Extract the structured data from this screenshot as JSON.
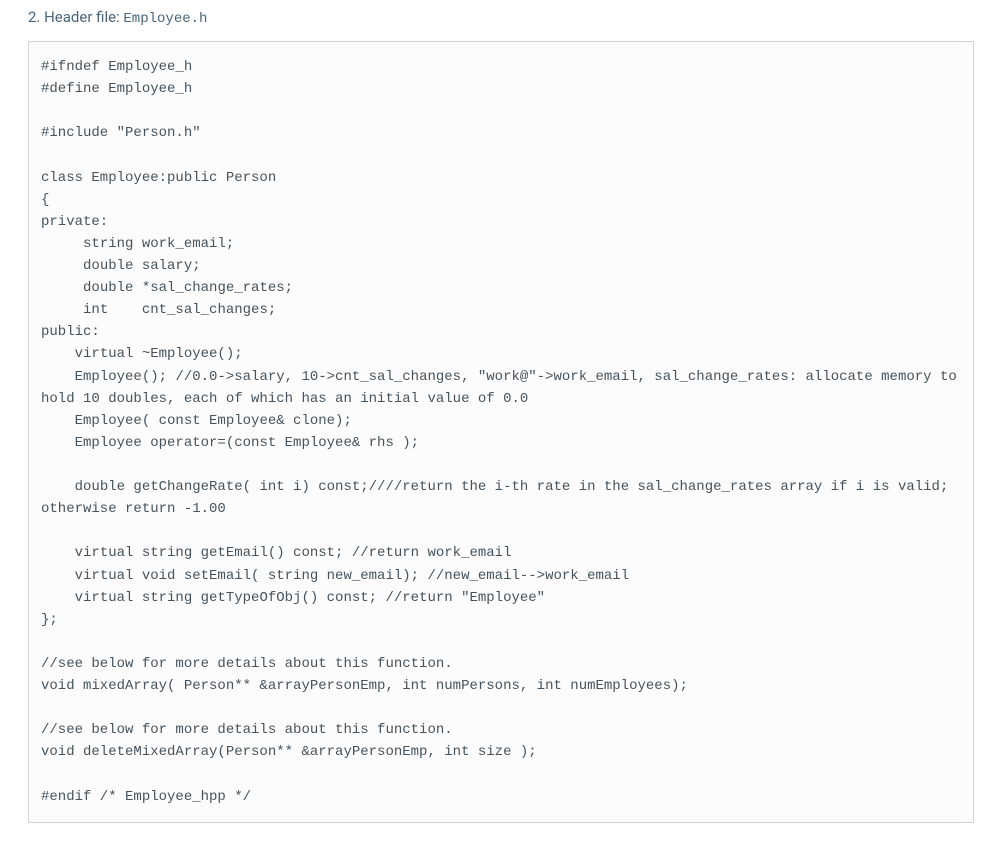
{
  "heading_prefix": "2. Header file: ",
  "heading_filename": "Employee.h",
  "code": "#ifndef Employee_h\n#define Employee_h\n\n#include \"Person.h\"\n\nclass Employee:public Person\n{\nprivate:\n     string work_email;\n     double salary;\n     double *sal_change_rates;\n     int    cnt_sal_changes;\npublic:\n    virtual ~Employee();\n    Employee(); //0.0->salary, 10->cnt_sal_changes, \"work@\"->work_email, sal_change_rates: allocate memory to hold 10 doubles, each of which has an initial value of 0.0\n    Employee( const Employee& clone);\n    Employee operator=(const Employee& rhs );\n\n    double getChangeRate( int i) const;////return the i-th rate in the sal_change_rates array if i is valid; otherwise return -1.00\n\n    virtual string getEmail() const; //return work_email\n    virtual void setEmail( string new_email); //new_email-->work_email\n    virtual string getTypeOfObj() const; //return \"Employee\"\n};\n\n//see below for more details about this function.\nvoid mixedArray( Person** &arrayPersonEmp, int numPersons, int numEmployees);\n\n//see below for more details about this function.\nvoid deleteMixedArray(Person** &arrayPersonEmp, int size );\n\n#endif /* Employee_hpp */"
}
